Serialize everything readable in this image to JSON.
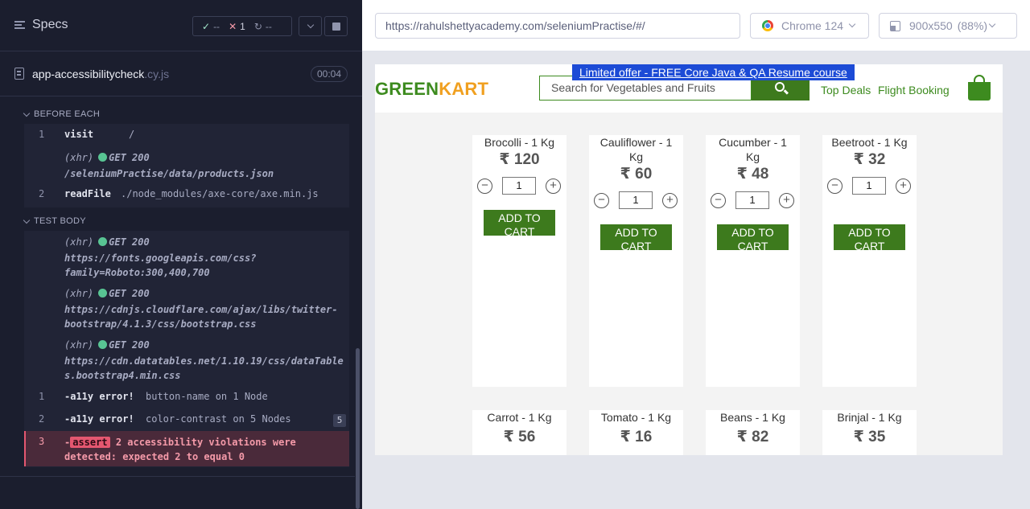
{
  "reporter": {
    "title": "Specs",
    "stats": {
      "passed": "--",
      "failed": "1",
      "pending": "--"
    },
    "spec_file": {
      "name": "app-accessibilitycheck",
      "ext": ".cy.js",
      "duration": "00:04"
    },
    "before_each": {
      "label": "BEFORE EACH",
      "commands": [
        {
          "num": "1",
          "name": "visit",
          "message": "/"
        },
        {
          "kind": "(xhr)",
          "method": "GET 200",
          "url": "/seleniumPractise/data/products.json"
        },
        {
          "num": "2",
          "name": "readFile",
          "message": "./node_modules/axe-core/axe.min.js"
        }
      ]
    },
    "test_body": {
      "label": "TEST BODY",
      "xhr": [
        {
          "kind": "(xhr)",
          "method": "GET 200",
          "url_line1": "https://fonts.googleapis.com/css?",
          "url_line2": "family=Roboto:300,400,700"
        },
        {
          "kind": "(xhr)",
          "method": "GET 200",
          "url_line1": "https://cdnjs.cloudflare.com/ajax/libs/twitter-",
          "url_line2": "bootstrap/4.1.3/css/bootstrap.css"
        },
        {
          "kind": "(xhr)",
          "method": "GET 200",
          "url_line1": "https://cdn.datatables.net/1.10.19/css/dataTable",
          "url_line2": "s.bootstrap4.min.css"
        }
      ],
      "errors": [
        {
          "num": "1",
          "name": "-a11y error!",
          "message": "button-name on 1 Node"
        },
        {
          "num": "2",
          "name": "-a11y error!",
          "message": "color-contrast on 5 Nodes",
          "count": "5"
        }
      ],
      "assert": {
        "num": "3",
        "dash": "-",
        "chip": "assert",
        "line1": " 2 accessibility violations were",
        "line2": "detected: expected 2 to equal 0"
      }
    }
  },
  "aut": {
    "url": "https://rahulshettyacademy.com/seleniumPractise/#/",
    "browser": "Chrome 124",
    "viewport": "900x550",
    "zoom": "(88%)"
  },
  "site": {
    "offer": "Limited offer - FREE Core Java & QA Resume course",
    "brand_green": "GREEN",
    "brand_orange": "KART",
    "search_placeholder": "Search for Vegetables and Fruits",
    "nav": [
      "Top Deals",
      "Flight Booking"
    ],
    "add_label": "ADD TO CART",
    "products": [
      {
        "name": "Brocolli - 1 Kg",
        "price": "₹ 120",
        "qty": "1"
      },
      {
        "name": "Cauliflower - 1 Kg",
        "price": "₹ 60",
        "qty": "1"
      },
      {
        "name": "Cucumber - 1 Kg",
        "price": "₹ 48",
        "qty": "1"
      },
      {
        "name": "Beetroot - 1 Kg",
        "price": "₹ 32",
        "qty": "1"
      },
      {
        "name": "Carrot - 1 Kg",
        "price": "₹ 56"
      },
      {
        "name": "Tomato - 1 Kg",
        "price": "₹ 16"
      },
      {
        "name": "Beans - 1 Kg",
        "price": "₹ 82"
      },
      {
        "name": "Brinjal - 1 Kg",
        "price": "₹ 35"
      }
    ]
  },
  "colors": {
    "reporter_bg": "#1b1e2e",
    "fail": "#e45770",
    "brand_green": "#3d8b1f",
    "brand_orange": "#f0a020",
    "offer_blue": "#1c4bd6"
  }
}
